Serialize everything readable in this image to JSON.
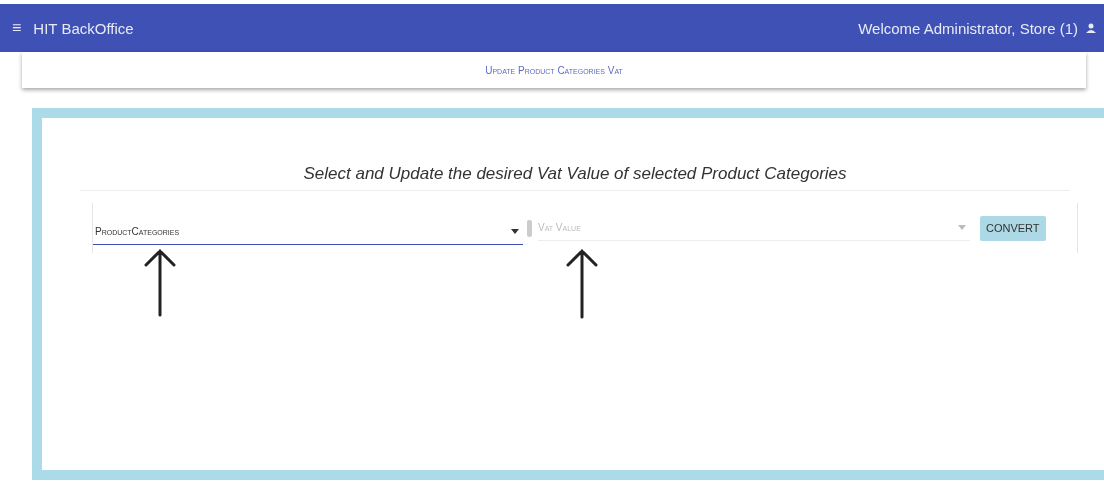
{
  "app_bar": {
    "menu_glyph": "≡",
    "title": "HIT BackOffice",
    "welcome": "Welcome Administrator, Store (1)"
  },
  "page_title": "Update Product Categories Vat",
  "panel": {
    "heading": "Select and Update the desired Vat Value of selected Product Categories",
    "category_select": {
      "value": "ProductCategories",
      "focused": true
    },
    "vat_select": {
      "placeholder": "Vat Value"
    },
    "convert_button": "CONVERT"
  }
}
